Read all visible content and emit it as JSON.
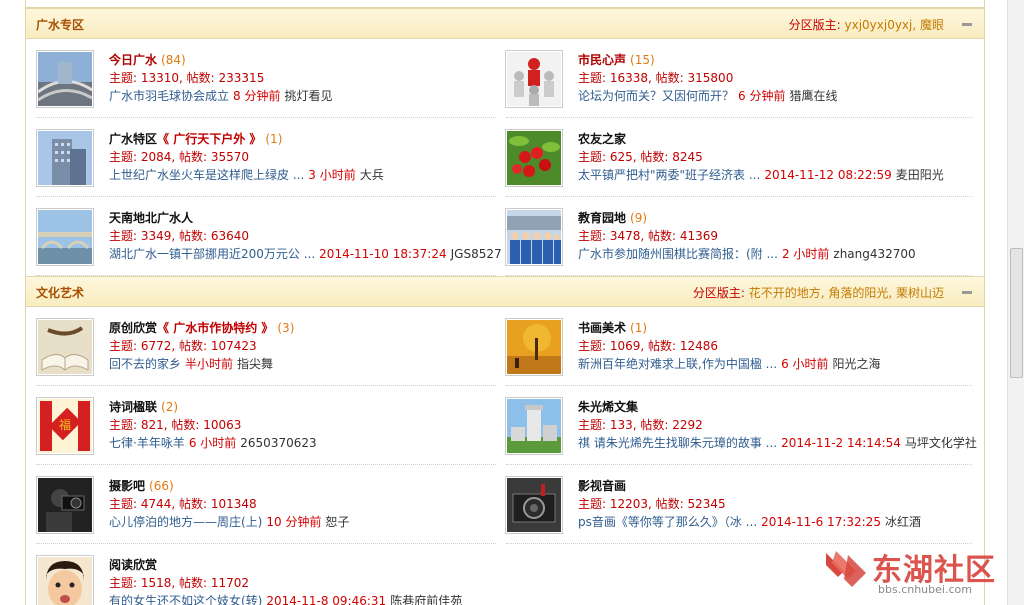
{
  "sections": [
    {
      "title": "广水专区",
      "mod_label": "分区版主:",
      "mod_names": "yxj0yxj0yxj, 魔眼",
      "rows": [
        [
          {
            "name": "今日广水",
            "suffix": "",
            "count": "(84)",
            "dark": false,
            "stats": "主题: 13310, 帖数: 233315",
            "last_title": "广水市羽毛球协会成立",
            "last_time": "8 分钟前",
            "last_user": "挑灯看见",
            "icon": "highway-image"
          },
          {
            "name": "市民心声",
            "suffix": "",
            "count": "(15)",
            "dark": false,
            "stats": "主题: 16338, 帖数: 315800",
            "last_title": "论坛为何而关？又因何而开？",
            "last_time": "6 分钟前",
            "last_user": "猎鹰在线",
            "icon": "people-figures-image"
          }
        ],
        [
          {
            "name": "广水特区",
            "suffix": "《 广行天下户外 》",
            "count": "(1)",
            "dark": true,
            "stats": "主题: 2084, 帖数: 35570",
            "last_title": "上世纪广水坐火车是这样爬上绿皮 ...",
            "last_time": "3 小时前",
            "last_user": "大兵",
            "icon": "building-image"
          },
          {
            "name": "农友之家",
            "suffix": "",
            "count": "",
            "dark": true,
            "stats": "主题: 625, 帖数: 8245",
            "last_title": "太平镇严把村\"两委\"班子经济表 ...",
            "last_time": "2014-11-12 08:22:59",
            "last_user": "麦田阳光",
            "icon": "cherries-image"
          }
        ],
        [
          {
            "name": "天南地北广水人",
            "suffix": "",
            "count": "",
            "dark": true,
            "stats": "主题: 3349, 帖数: 63640",
            "last_title": "湖北广水一镇干部挪用近200万元公 ...",
            "last_time": "2014-11-10 18:37:24",
            "last_user": "JGS8527",
            "icon": "bridge-image"
          },
          {
            "name": "教育园地",
            "suffix": "",
            "count": "(9)",
            "dark": true,
            "stats": "主题: 3478, 帖数: 41369",
            "last_title": "广水市参加随州围棋比赛简报：(附 ...",
            "last_time": "2 小时前",
            "last_user": "zhang432700",
            "icon": "students-image"
          }
        ]
      ]
    },
    {
      "title": "文化艺术",
      "mod_label": "分区版主:",
      "mod_names": "花不开的地方, 角落的阳光, 栗树山迈",
      "rows": [
        [
          {
            "name": "原创欣赏",
            "suffix": "《 广水市作协特约 》",
            "count": "(3)",
            "dark": true,
            "stats": "主题: 6772, 帖数: 107423",
            "last_title": "回不去的家乡",
            "last_time": "半小时前",
            "last_user": "指尖舞",
            "icon": "book-image"
          },
          {
            "name": "书画美术",
            "suffix": "",
            "count": "(1)",
            "dark": true,
            "stats": "主题: 1069, 帖数: 12486",
            "last_title": "新洲百年绝对难求上联,作为中国楹 ...",
            "last_time": "6 小时前",
            "last_user": "阳光之海",
            "icon": "autumn-painting-image"
          }
        ],
        [
          {
            "name": "诗词楹联",
            "suffix": "",
            "count": "(2)",
            "dark": true,
            "stats": "主题: 821, 帖数: 10063",
            "last_title": "七律·羊年咏羊",
            "last_time": "6 小时前",
            "last_user": "2650370623",
            "icon": "couplet-image"
          },
          {
            "name": "朱光烯文集",
            "suffix": "",
            "count": "",
            "dark": true,
            "stats": "主题: 133, 帖数: 2292",
            "last_title": "祺 请朱光烯先生找聊朱元璋的故事 ...",
            "last_time": "2014-11-2 14:14:54",
            "last_user": "马坪文化学社",
            "icon": "tower-image"
          }
        ],
        [
          {
            "name": "摄影吧",
            "suffix": "",
            "count": "(66)",
            "dark": true,
            "stats": "主题: 4744, 帖数: 101348",
            "last_title": "心儿停泊的地方——周庄(上)",
            "last_time": "10 分钟前",
            "last_user": "恕子",
            "icon": "photographer-image"
          },
          {
            "name": "影视音画",
            "suffix": "",
            "count": "",
            "dark": true,
            "stats": "主题: 12203, 帖数: 52345",
            "last_title": "ps音画《等你等了那么久》（冰 ...",
            "last_time": "2014-11-6 17:32:25",
            "last_user": "冰红酒",
            "icon": "camera-image"
          }
        ],
        [
          {
            "name": "阅读欣赏",
            "suffix": "",
            "count": "",
            "dark": true,
            "stats": "主题: 1518, 帖数: 11702",
            "last_title": "有的女生还不如这个妓女(转)",
            "last_time": "2014-11-8 09:46:31",
            "last_user": "陈巷府前佳苑",
            "icon": "child-face-image"
          }
        ]
      ]
    }
  ],
  "watermark": {
    "text": "东湖社区",
    "url": "bbs.cnhubei.com"
  },
  "colors": {
    "header_title": "#a84f00",
    "forum_name": "#b00000",
    "stats": "#c00000",
    "link": "#2f5d8f",
    "time": "#d40000",
    "count": "#e07a10"
  }
}
